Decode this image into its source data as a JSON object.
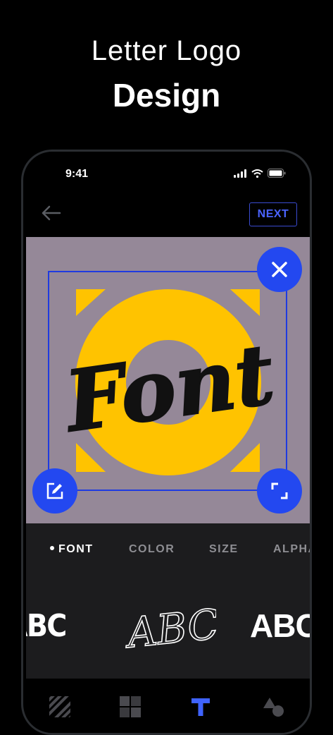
{
  "headline": {
    "line1": "Letter Logo",
    "line2": "Design"
  },
  "status_bar": {
    "time": "9:41"
  },
  "top_bar": {
    "next_label": "NEXT",
    "back_icon": "arrow-left-icon"
  },
  "canvas": {
    "background": "#958898",
    "logo_text": "Font",
    "ring_color": "#ffc300",
    "selection_color": "#1f3be0",
    "handles": [
      "close-icon",
      "edit-icon",
      "resize-icon"
    ]
  },
  "tabs": [
    {
      "label": "FONT",
      "active": true
    },
    {
      "label": "COLOR",
      "active": false
    },
    {
      "label": "SIZE",
      "active": false
    },
    {
      "label": "ALPHA",
      "active": false
    }
  ],
  "font_samples": [
    "ABC",
    "ABC",
    "ABC"
  ],
  "bottom_nav": [
    "texture-icon",
    "grid-icon",
    "text-icon",
    "shapes-icon"
  ],
  "colors": {
    "accent": "#2348f0",
    "active_nav": "#3f63ff",
    "toolbar_bg": "#1c1c1e"
  }
}
